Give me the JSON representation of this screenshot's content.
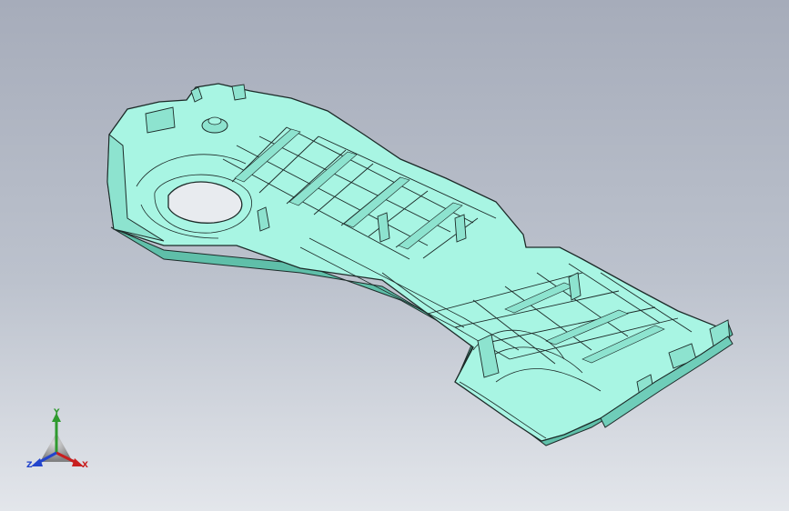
{
  "viewport": {
    "background_top": "#a6acba",
    "background_bottom": "#e3e6eb"
  },
  "model": {
    "part_color": "#a8f5e3",
    "edge_color": "#1c2a28",
    "shade_color": "#6fcdb9"
  },
  "triad": {
    "y_label": "Y",
    "x_label": "X",
    "z_label": "Z",
    "y_color": "#2f9a2f",
    "x_color": "#c81f1f",
    "z_color": "#2244cc"
  }
}
